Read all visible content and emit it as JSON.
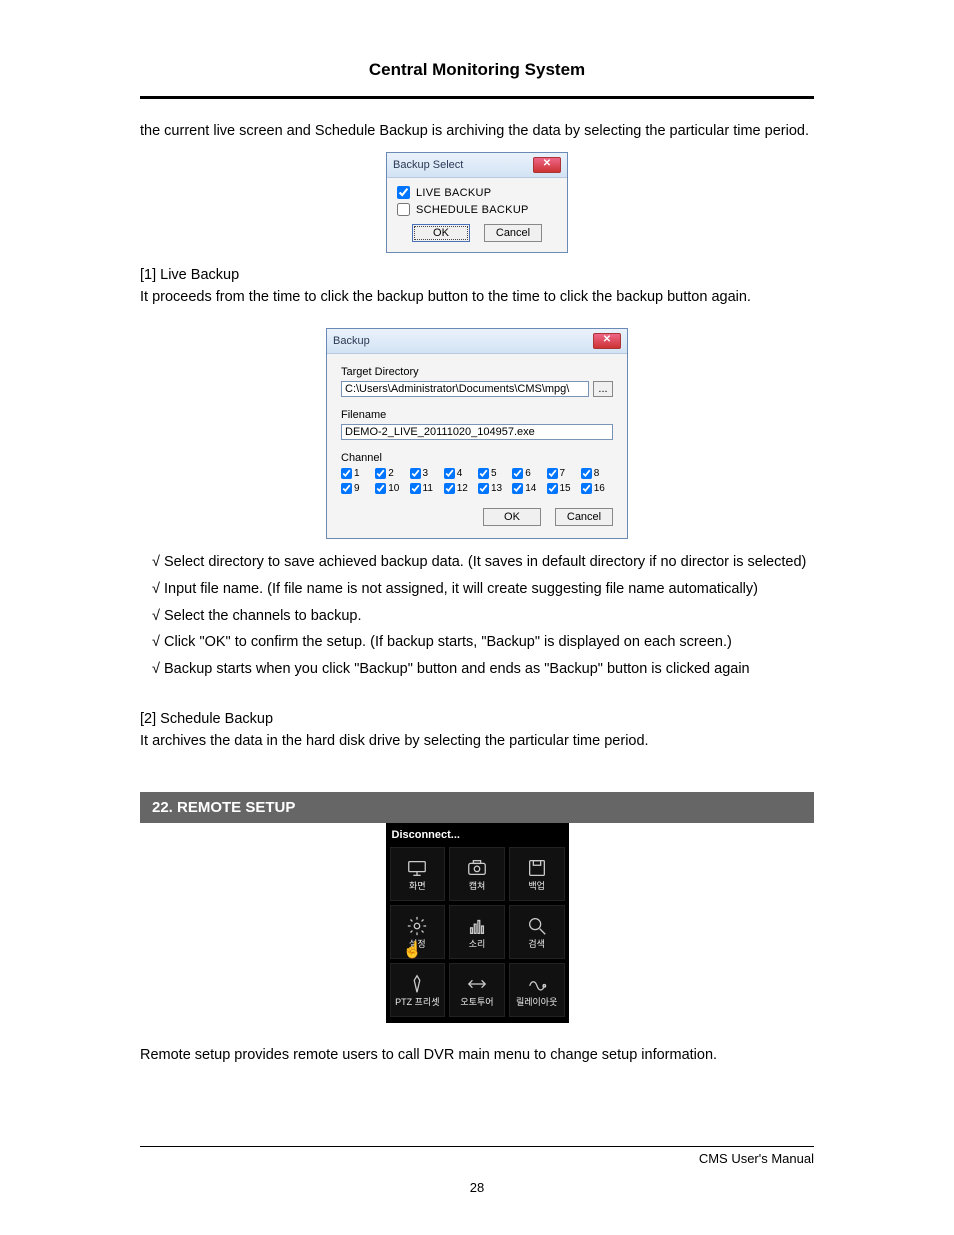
{
  "header": {
    "title": "Central Monitoring System"
  },
  "intro": "the current live screen and Schedule Backup is archiving the data by selecting the particular time period.",
  "backup_select": {
    "title": "Backup Select",
    "live": "LIVE BACKUP",
    "schedule": "SCHEDULE BACKUP",
    "ok": "OK",
    "cancel": "Cancel"
  },
  "section1": {
    "heading": "[1] Live Backup",
    "desc": "It proceeds from the time to click the backup button to the time to click the backup button again."
  },
  "backup_dialog": {
    "title": "Backup",
    "target_label": "Target Directory",
    "target_value": "C:\\Users\\Administrator\\Documents\\CMS\\mpg\\",
    "browse": "...",
    "filename_label": "Filename",
    "filename_value": "DEMO-2_LIVE_20111020_104957.exe",
    "channel_label": "Channel",
    "channels": [
      "1",
      "2",
      "3",
      "4",
      "5",
      "6",
      "7",
      "8",
      "9",
      "10",
      "11",
      "12",
      "13",
      "14",
      "15",
      "16"
    ],
    "ok": "OK",
    "cancel": "Cancel"
  },
  "bullets": [
    "Select directory to save achieved backup data. (It saves in default directory if no director is selected)",
    "Input file name. (If file name is not assigned, it will create suggesting file name automatically)",
    "Select the channels to backup.",
    "Click \"OK\" to confirm the setup. (If backup starts, \"Backup\" is displayed on each screen.)",
    "Backup starts when you click \"Backup\" button and ends as \"Backup\" button is clicked again"
  ],
  "section2": {
    "heading": "[2] Schedule Backup",
    "desc": "It archives the data in the hard disk drive by selecting the particular time period."
  },
  "remote_section": {
    "title": "22. REMOTE SETUP",
    "panel_title": "Disconnect...",
    "cells": [
      {
        "name": "screen",
        "label": "화면"
      },
      {
        "name": "capture",
        "label": "캡쳐"
      },
      {
        "name": "backup",
        "label": "백업"
      },
      {
        "name": "setup",
        "label": "설정"
      },
      {
        "name": "sound",
        "label": "소리"
      },
      {
        "name": "search",
        "label": "검색"
      },
      {
        "name": "ptz-preset",
        "label": "PTZ 프리셋"
      },
      {
        "name": "auto-tour",
        "label": "오토투어"
      },
      {
        "name": "relay-out",
        "label": "릴레이아웃"
      }
    ],
    "desc": "Remote setup provides remote users to call DVR main menu to change setup information."
  },
  "footer": {
    "manual": "CMS User's Manual",
    "page": "28"
  }
}
